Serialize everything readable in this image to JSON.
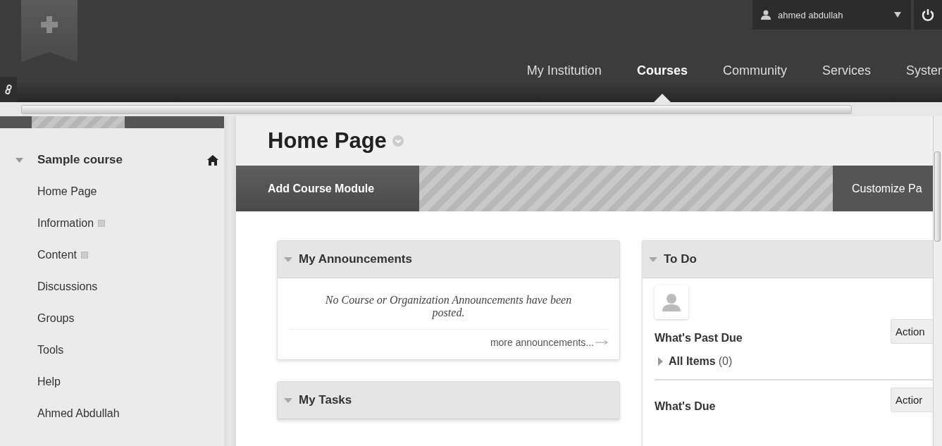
{
  "user_menu": {
    "name": "ahmed abdullah"
  },
  "nav_tabs": [
    {
      "label": "My Institution",
      "selected": false
    },
    {
      "label": "Courses",
      "selected": true
    },
    {
      "label": "Community",
      "selected": false
    },
    {
      "label": "Services",
      "selected": false
    },
    {
      "label": "Syster",
      "selected": false
    }
  ],
  "sidebar": {
    "course": {
      "title": "Sample course",
      "expanded": true
    },
    "items": [
      {
        "label": "Home Page",
        "has_icon": false
      },
      {
        "label": "Information",
        "has_icon": true
      },
      {
        "label": "Content",
        "has_icon": true
      },
      {
        "label": "Discussions",
        "has_icon": false
      },
      {
        "label": "Groups",
        "has_icon": false
      },
      {
        "label": "Tools",
        "has_icon": false
      },
      {
        "label": "Help",
        "has_icon": false
      },
      {
        "label": "Ahmed Abdullah",
        "has_icon": false
      }
    ]
  },
  "page": {
    "title": "Home Page"
  },
  "toolbar": {
    "add_button": "Add Course Module",
    "customize_button": "Customize Pa"
  },
  "announcements": {
    "title": "My Announcements",
    "expanded": true,
    "message": "No Course or Organization Announcements have been posted.",
    "more_link": "more announcements..."
  },
  "tasks": {
    "title": "My Tasks",
    "expanded": true
  },
  "todo": {
    "title": "To Do",
    "expanded": true,
    "sections": [
      {
        "title": "What's Past Due",
        "action": "Action",
        "groups": [
          {
            "label": "All Items",
            "count": "(0)",
            "expanded": false
          }
        ]
      },
      {
        "title": "What's Due",
        "action": "Actior"
      }
    ]
  }
}
